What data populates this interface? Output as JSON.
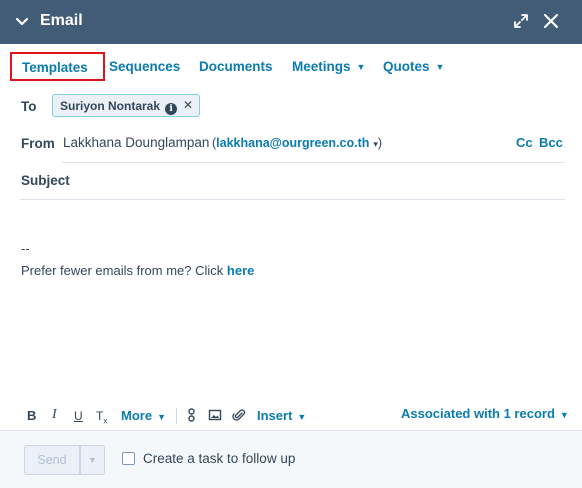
{
  "header": {
    "title": "Email",
    "collapse_icon": "chevron-down-icon",
    "expand_icon": "expand-icon",
    "close_icon": "close-icon",
    "background": "#425b76"
  },
  "tabs": [
    {
      "label": "Templates",
      "highlighted": true
    },
    {
      "label": "Sequences"
    },
    {
      "label": "Documents"
    },
    {
      "label": "Meetings",
      "dropdown": true
    },
    {
      "label": "Quotes",
      "dropdown": true
    }
  ],
  "to": {
    "label": "To",
    "recipient": "Suriyon Nontarak"
  },
  "from": {
    "label": "From",
    "name": "Lakkhana Dounglampan",
    "email": "lakkhana@ourgreen.co.th",
    "cc": "Cc",
    "bcc": "Bcc"
  },
  "subject": {
    "label": "Subject",
    "value": ""
  },
  "body": {
    "signature_dash": "--",
    "signature_text": "Prefer fewer emails from me? Click",
    "signature_link": "here"
  },
  "toolbar": {
    "bold": "B",
    "italic": "I",
    "underline": "U",
    "clear_format": "Tx",
    "more": "More",
    "insert": "Insert",
    "associated": "Associated with 1 record"
  },
  "footer": {
    "send": "Send",
    "task_label": "Create a task to follow up",
    "task_checked": false
  },
  "colors": {
    "accent": "#0b7cb0",
    "highlight_border": "#e0121b",
    "text": "#33475b"
  }
}
